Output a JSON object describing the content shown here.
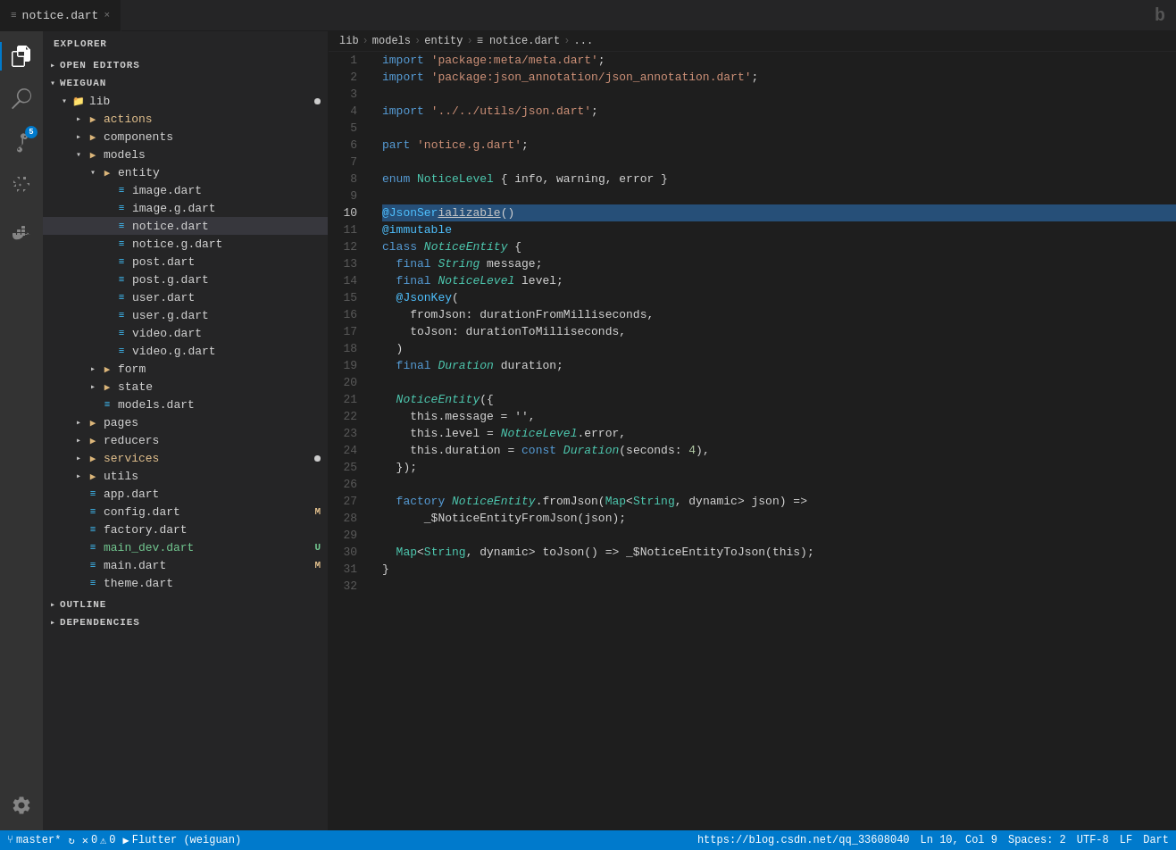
{
  "activityBar": {
    "icons": [
      {
        "name": "files-icon",
        "symbol": "⬜",
        "label": "Explorer",
        "active": true,
        "badge": null
      },
      {
        "name": "search-icon",
        "symbol": "🔍",
        "label": "Search",
        "active": false,
        "badge": null
      },
      {
        "name": "source-control-icon",
        "symbol": "⑂",
        "label": "Source Control",
        "active": false,
        "badge": "5"
      },
      {
        "name": "extensions-icon",
        "symbol": "⊞",
        "label": "Extensions",
        "active": false,
        "badge": null
      },
      {
        "name": "docker-icon",
        "symbol": "🐳",
        "label": "Docker",
        "active": false,
        "badge": null
      }
    ],
    "bottomIcons": [
      {
        "name": "settings-icon",
        "symbol": "⚙",
        "label": "Settings"
      }
    ]
  },
  "sidebar": {
    "title": "EXPLORER",
    "sections": [
      {
        "label": "OPEN EDITORS",
        "expanded": false
      },
      {
        "label": "WEIGUAN",
        "expanded": true
      }
    ]
  },
  "fileTree": {
    "root": "lib",
    "items": [
      {
        "label": "actions",
        "type": "folder",
        "depth": 1,
        "expanded": false,
        "color": "yellow"
      },
      {
        "label": "components",
        "type": "folder",
        "depth": 1,
        "expanded": false
      },
      {
        "label": "models",
        "type": "folder",
        "depth": 1,
        "expanded": true
      },
      {
        "label": "entity",
        "type": "folder",
        "depth": 2,
        "expanded": true
      },
      {
        "label": "image.dart",
        "type": "file",
        "depth": 3,
        "icon": "≡"
      },
      {
        "label": "image.g.dart",
        "type": "file",
        "depth": 3,
        "icon": "≡"
      },
      {
        "label": "notice.dart",
        "type": "file",
        "depth": 3,
        "icon": "≡",
        "active": true
      },
      {
        "label": "notice.g.dart",
        "type": "file",
        "depth": 3,
        "icon": "≡"
      },
      {
        "label": "post.dart",
        "type": "file",
        "depth": 3,
        "icon": "≡"
      },
      {
        "label": "post.g.dart",
        "type": "file",
        "depth": 3,
        "icon": "≡"
      },
      {
        "label": "user.dart",
        "type": "file",
        "depth": 3,
        "icon": "≡"
      },
      {
        "label": "user.g.dart",
        "type": "file",
        "depth": 3,
        "icon": "≡"
      },
      {
        "label": "video.dart",
        "type": "file",
        "depth": 3,
        "icon": "≡"
      },
      {
        "label": "video.g.dart",
        "type": "file",
        "depth": 3,
        "icon": "≡"
      },
      {
        "label": "form",
        "type": "folder",
        "depth": 2,
        "expanded": false
      },
      {
        "label": "state",
        "type": "folder",
        "depth": 2,
        "expanded": false
      },
      {
        "label": "models.dart",
        "type": "file",
        "depth": 2,
        "icon": "≡"
      },
      {
        "label": "pages",
        "type": "folder",
        "depth": 1,
        "expanded": false
      },
      {
        "label": "reducers",
        "type": "folder",
        "depth": 1,
        "expanded": false
      },
      {
        "label": "services",
        "type": "folder",
        "depth": 1,
        "expanded": false,
        "color": "yellow",
        "dot": true
      },
      {
        "label": "utils",
        "type": "folder",
        "depth": 1,
        "expanded": false
      },
      {
        "label": "app.dart",
        "type": "file",
        "depth": 1,
        "icon": "≡"
      },
      {
        "label": "config.dart",
        "type": "file",
        "depth": 1,
        "icon": "≡",
        "badge": "M"
      },
      {
        "label": "factory.dart",
        "type": "file",
        "depth": 1,
        "icon": "≡"
      },
      {
        "label": "main_dev.dart",
        "type": "file",
        "depth": 1,
        "icon": "≡",
        "badge": "U"
      },
      {
        "label": "main.dart",
        "type": "file",
        "depth": 1,
        "icon": "≡",
        "badge": "M"
      },
      {
        "label": "theme.dart",
        "type": "file",
        "depth": 1,
        "icon": "≡"
      }
    ]
  },
  "outline": {
    "label": "OUTLINE",
    "expanded": true
  },
  "dependencies": {
    "label": "DEPENDENCIES",
    "expanded": false
  },
  "tab": {
    "icon": "≡",
    "filename": "notice.dart",
    "close": "×"
  },
  "breadcrumb": {
    "items": [
      "lib",
      "models",
      "entity",
      "notice.dart",
      "..."
    ]
  },
  "code": {
    "lines": [
      {
        "num": 1,
        "tokens": [
          {
            "t": "kw",
            "v": "import"
          },
          {
            "t": "op",
            "v": " "
          },
          {
            "t": "str",
            "v": "'package:meta/meta.dart'"
          },
          {
            "t": "op",
            "v": ";"
          }
        ]
      },
      {
        "num": 2,
        "tokens": [
          {
            "t": "kw",
            "v": "import"
          },
          {
            "t": "op",
            "v": " "
          },
          {
            "t": "str",
            "v": "'package:json_annotation/json_annotation.dart'"
          },
          {
            "t": "op",
            "v": ";"
          }
        ]
      },
      {
        "num": 3,
        "tokens": []
      },
      {
        "num": 4,
        "tokens": [
          {
            "t": "kw",
            "v": "import"
          },
          {
            "t": "op",
            "v": " "
          },
          {
            "t": "str",
            "v": "'../../utils/json.dart'"
          },
          {
            "t": "op",
            "v": ";"
          }
        ]
      },
      {
        "num": 5,
        "tokens": []
      },
      {
        "num": 6,
        "tokens": [
          {
            "t": "kw",
            "v": "part"
          },
          {
            "t": "op",
            "v": " "
          },
          {
            "t": "str",
            "v": "'notice.g.dart'"
          },
          {
            "t": "op",
            "v": ";"
          }
        ]
      },
      {
        "num": 7,
        "tokens": []
      },
      {
        "num": 8,
        "tokens": [
          {
            "t": "kw",
            "v": "enum"
          },
          {
            "t": "op",
            "v": " "
          },
          {
            "t": "cls",
            "v": "NoticeLevel"
          },
          {
            "t": "op",
            "v": " { "
          },
          {
            "t": "op",
            "v": "info, warning, error"
          },
          {
            "t": "op",
            "v": " }"
          }
        ]
      },
      {
        "num": 9,
        "tokens": []
      },
      {
        "num": 10,
        "active": true,
        "tokens": [
          {
            "t": "annotation",
            "v": "@JsonSerializable"
          },
          {
            "t": "op",
            "v": "()"
          }
        ]
      },
      {
        "num": 11,
        "tokens": [
          {
            "t": "annotation",
            "v": "@immutable"
          }
        ]
      },
      {
        "num": 12,
        "tokens": [
          {
            "t": "kw",
            "v": "class"
          },
          {
            "t": "op",
            "v": " "
          },
          {
            "t": "cls italic",
            "v": "NoticeEntity"
          },
          {
            "t": "op",
            "v": " {"
          }
        ]
      },
      {
        "num": 13,
        "tokens": [
          {
            "t": "op",
            "v": "  "
          },
          {
            "t": "kw",
            "v": "final"
          },
          {
            "t": "op",
            "v": " "
          },
          {
            "t": "cls italic",
            "v": "String"
          },
          {
            "t": "op",
            "v": " message;"
          }
        ]
      },
      {
        "num": 14,
        "tokens": [
          {
            "t": "op",
            "v": "  "
          },
          {
            "t": "kw",
            "v": "final"
          },
          {
            "t": "op",
            "v": " "
          },
          {
            "t": "cls italic",
            "v": "NoticeLevel"
          },
          {
            "t": "op",
            "v": " level;"
          }
        ]
      },
      {
        "num": 15,
        "tokens": [
          {
            "t": "op",
            "v": "  "
          },
          {
            "t": "annotation",
            "v": "@JsonKey"
          },
          {
            "t": "op",
            "v": "("
          }
        ]
      },
      {
        "num": 16,
        "tokens": [
          {
            "t": "op",
            "v": "    fromJson: durationFromMilliseconds,"
          }
        ]
      },
      {
        "num": 17,
        "tokens": [
          {
            "t": "op",
            "v": "    toJson: durationToMilliseconds,"
          }
        ]
      },
      {
        "num": 18,
        "tokens": [
          {
            "t": "op",
            "v": "  )"
          }
        ]
      },
      {
        "num": 19,
        "tokens": [
          {
            "t": "op",
            "v": "  "
          },
          {
            "t": "kw",
            "v": "final"
          },
          {
            "t": "op",
            "v": " "
          },
          {
            "t": "cls italic",
            "v": "Duration"
          },
          {
            "t": "op",
            "v": " duration;"
          }
        ]
      },
      {
        "num": 20,
        "tokens": []
      },
      {
        "num": 21,
        "tokens": [
          {
            "t": "op",
            "v": "  "
          },
          {
            "t": "cls italic",
            "v": "NoticeEntity"
          },
          {
            "t": "op",
            "v": "({"
          }
        ]
      },
      {
        "num": 22,
        "tokens": [
          {
            "t": "op",
            "v": "    this.message = ''"
          },
          {
            "t": "op",
            "v": ","
          }
        ]
      },
      {
        "num": 23,
        "tokens": [
          {
            "t": "op",
            "v": "    this.level = "
          },
          {
            "t": "cls italic",
            "v": "NoticeLevel"
          },
          {
            "t": "op",
            "v": ".error,"
          }
        ]
      },
      {
        "num": 24,
        "tokens": [
          {
            "t": "op",
            "v": "    this.duration = "
          },
          {
            "t": "kw",
            "v": "const"
          },
          {
            "t": "op",
            "v": " "
          },
          {
            "t": "cls italic",
            "v": "Duration"
          },
          {
            "t": "op",
            "v": "(seconds: "
          },
          {
            "t": "num",
            "v": "4"
          },
          {
            "t": "op",
            "v": "),"
          }
        ]
      },
      {
        "num": 25,
        "tokens": [
          {
            "t": "op",
            "v": "  });"
          }
        ]
      },
      {
        "num": 26,
        "tokens": []
      },
      {
        "num": 27,
        "tokens": [
          {
            "t": "op",
            "v": "  "
          },
          {
            "t": "kw",
            "v": "factory"
          },
          {
            "t": "op",
            "v": " "
          },
          {
            "t": "cls italic",
            "v": "NoticeEntity"
          },
          {
            "t": "op",
            "v": ".fromJson("
          },
          {
            "t": "cls",
            "v": "Map"
          },
          {
            "t": "op",
            "v": "<"
          },
          {
            "t": "cls",
            "v": "String"
          },
          {
            "t": "op",
            "v": ", dynamic> json) =>"
          }
        ]
      },
      {
        "num": 28,
        "tokens": [
          {
            "t": "op",
            "v": "      _$NoticeEntityFromJson(json);"
          }
        ]
      },
      {
        "num": 29,
        "tokens": []
      },
      {
        "num": 30,
        "tokens": [
          {
            "t": "op",
            "v": "  "
          },
          {
            "t": "cls",
            "v": "Map"
          },
          {
            "t": "op",
            "v": "<"
          },
          {
            "t": "cls",
            "v": "String"
          },
          {
            "t": "op",
            "v": ", dynamic> toJson() => _$NoticeEntityToJson(this);"
          }
        ]
      },
      {
        "num": 31,
        "tokens": [
          {
            "t": "op",
            "v": "}"
          }
        ]
      },
      {
        "num": 32,
        "tokens": []
      }
    ]
  },
  "statusBar": {
    "branch": "master*",
    "errors": "0",
    "warnings": "0",
    "flutter": "Flutter (weiguan)",
    "position": "Ln 10, Col 9",
    "spaces": "Spaces: 2",
    "encoding": "UTF-8",
    "lineEnding": "LF",
    "language": "Dart",
    "url": "https://blog.csdn.net/qq_33608040"
  }
}
